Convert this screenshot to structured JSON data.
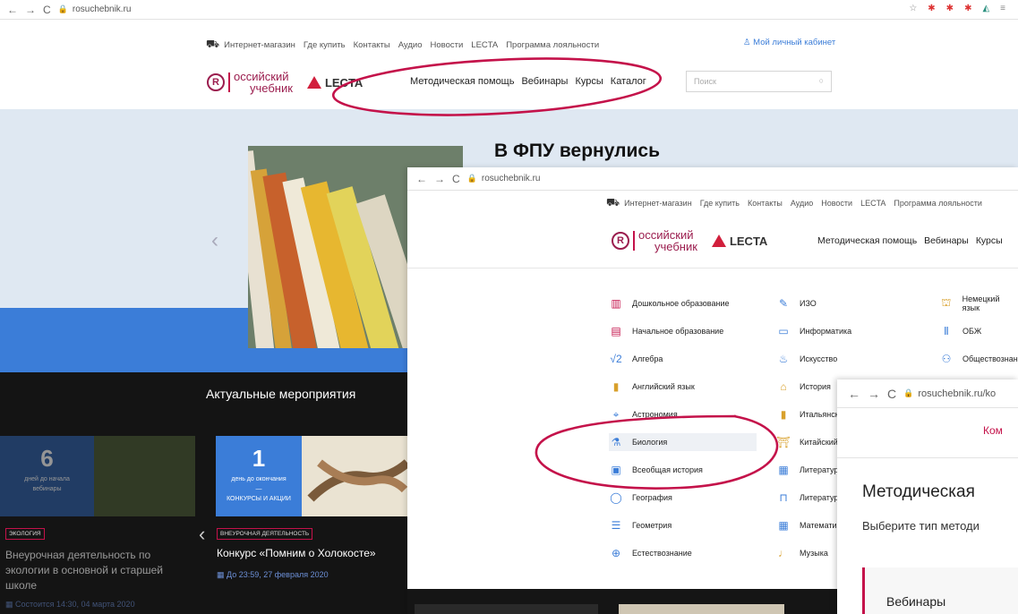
{
  "win1": {
    "url": "rosuchebnik.ru",
    "browser_icons": [
      "star-icon",
      "extension-icon",
      "profile-icon",
      "menu-icon"
    ],
    "topline": [
      "Интернет-магазин",
      "Где купить",
      "Контакты",
      "Аудио",
      "Новости",
      "LECTA",
      "Программа лояльности"
    ],
    "cabinet": "Мой личный кабинет",
    "logo_line1": "оссийский",
    "logo_line2": "учебник",
    "logo_lecta": "LECTA",
    "nav": [
      "Методическая помощь",
      "Вебинары",
      "Курсы",
      "Каталог"
    ],
    "search_placeholder": "Поиск",
    "hero_title": "В ФПУ вернулись",
    "events_title": "Актуальные мероприятия",
    "card_left": {
      "num": "6",
      "line1": "дней до начала",
      "line2": "вебинары"
    },
    "card_right": {
      "num": "1",
      "line1": "день до окончания",
      "line2": "—",
      "line3": "КОНКУРСЫ И АКЦИИ"
    },
    "left_tag": "ЭКОЛОГИЯ",
    "left_event": [
      "Внеурочная деятельность по",
      "экологии в основной и старшей",
      "школе"
    ],
    "left_date": "Состоится 14:30, 04 марта 2020",
    "right_tag": "ВНЕУРОЧНАЯ ДЕЯТЕЛЬНОСТЬ",
    "right_event": "Конкурс «Помним о Холокосте»",
    "right_date": "До 23:59, 27 февраля 2020"
  },
  "win2": {
    "url": "rosuchebnik.ru",
    "topline": [
      "Интернет-магазин",
      "Где купить",
      "Контакты",
      "Аудио",
      "Новости",
      "LECTA",
      "Программа лояльности"
    ],
    "logo_line1": "оссийский",
    "logo_line2": "учебник",
    "logo_lecta": "LECTA",
    "nav": [
      "Методическая помощь",
      "Вебинары",
      "Курсы"
    ],
    "col1": [
      "Дошкольное образование",
      "Начальное образование",
      "Алгебра",
      "Английский язык",
      "Астрономия",
      "Биология",
      "Всеобщая история",
      "География",
      "Геометрия",
      "Естествознание"
    ],
    "col2": [
      "ИЗО",
      "Информатика",
      "Искусство",
      "История",
      "Итальянский",
      "Китайский",
      "Литература",
      "Литература",
      "Математика",
      "Музыка"
    ],
    "col3": [
      "Немецкий язык",
      "ОБЖ",
      "Обществознание"
    ],
    "selected_index": 5
  },
  "win3": {
    "url": "rosuchebnik.ru/ko",
    "top_link": "Ком",
    "heading": "Методическая",
    "subtitle": "Выберите тип методи",
    "card_title": "Вебинары"
  },
  "colors": {
    "brand": "#9b1d4e",
    "accent": "#c4124a",
    "blue": "#3b7dd8",
    "annotation": "#c4124a"
  }
}
